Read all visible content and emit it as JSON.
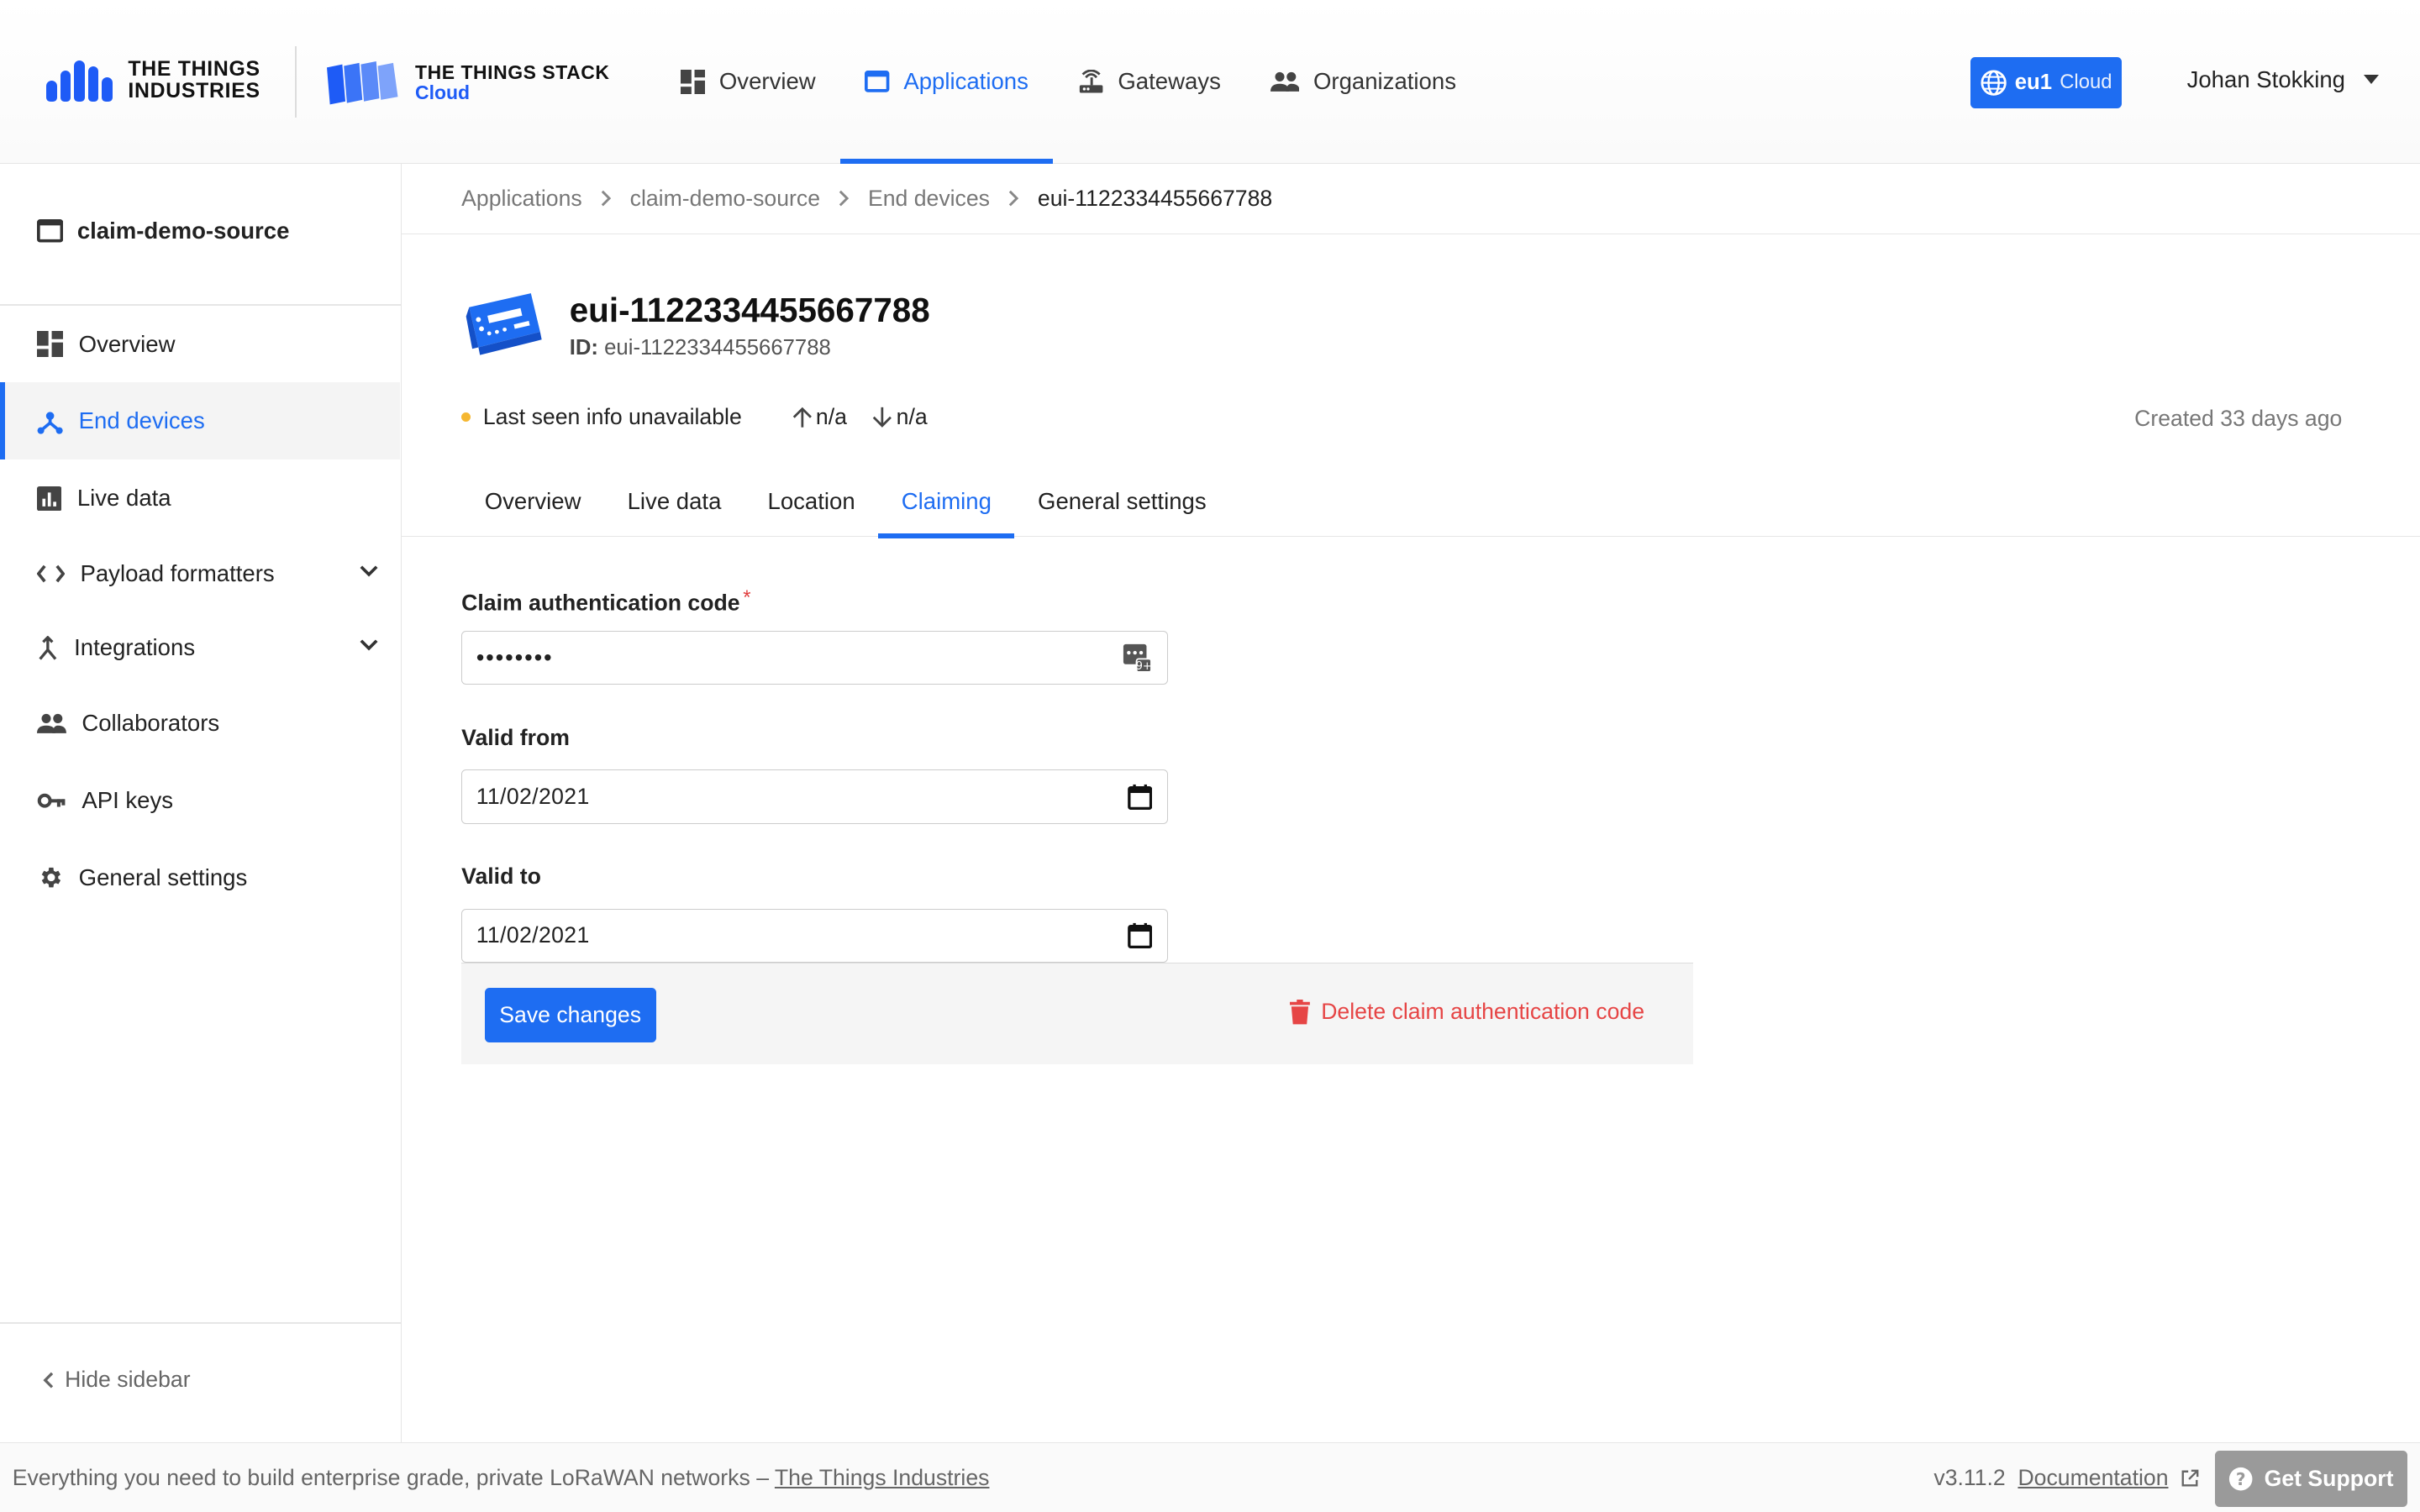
{
  "header": {
    "brand_company_line1": "THE THINGS",
    "brand_company_line2": "INDUSTRIES",
    "brand_product_line1": "THE THINGS STACK",
    "brand_product_line2": "Cloud",
    "nav": [
      {
        "label": "Overview",
        "icon": "dashboard-icon"
      },
      {
        "label": "Applications",
        "icon": "application-window-icon",
        "active": true
      },
      {
        "label": "Gateways",
        "icon": "gateway-router-icon"
      },
      {
        "label": "Organizations",
        "icon": "people-icon"
      }
    ],
    "region_name": "eu1",
    "region_suffix": "Cloud",
    "user_name": "Johan Stokking"
  },
  "sidebar": {
    "app_title": "claim-demo-source",
    "items": [
      {
        "label": "Overview",
        "icon": "dashboard-icon"
      },
      {
        "label": "End devices",
        "icon": "device-hub-icon",
        "active": true
      },
      {
        "label": "Live data",
        "icon": "bar-chart-icon"
      },
      {
        "label": "Payload formatters",
        "icon": "code-icon",
        "expandable": true
      },
      {
        "label": "Integrations",
        "icon": "merge-icon",
        "expandable": true
      },
      {
        "label": "Collaborators",
        "icon": "people-icon"
      },
      {
        "label": "API keys",
        "icon": "key-icon"
      },
      {
        "label": "General settings",
        "icon": "gear-icon"
      }
    ],
    "hide_label": "Hide sidebar"
  },
  "breadcrumb": [
    "Applications",
    "claim-demo-source",
    "End devices",
    "eui-1122334455667788"
  ],
  "device": {
    "name": "eui-1122334455667788",
    "id_label": "ID:",
    "id_value": "eui-1122334455667788",
    "last_seen": "Last seen info unavailable",
    "uplink": "n/a",
    "downlink": "n/a",
    "created": "Created 33 days ago"
  },
  "tabs": [
    "Overview",
    "Live data",
    "Location",
    "Claiming",
    "General settings"
  ],
  "active_tab": "Claiming",
  "form": {
    "claim_code_label": "Claim authentication code",
    "claim_code_required_mark": "*",
    "claim_code_value": "••••••••",
    "valid_from_label": "Valid from",
    "valid_from_value": "11/02/2021",
    "valid_to_label": "Valid to",
    "valid_to_value": "11/02/2021",
    "save_label": "Save changes",
    "delete_label": "Delete claim authentication code"
  },
  "footer": {
    "tagline": "Everything you need to build enterprise grade, private LoRaWAN networks – ",
    "tagline_link": "The Things Industries",
    "version": "v3.11.2",
    "docs_label": "Documentation",
    "support_label": "Get Support"
  },
  "colors": {
    "accent": "#1e6df2",
    "danger": "#e64545",
    "status_dot": "#f5b731",
    "support_button": "#9a9a9a"
  }
}
